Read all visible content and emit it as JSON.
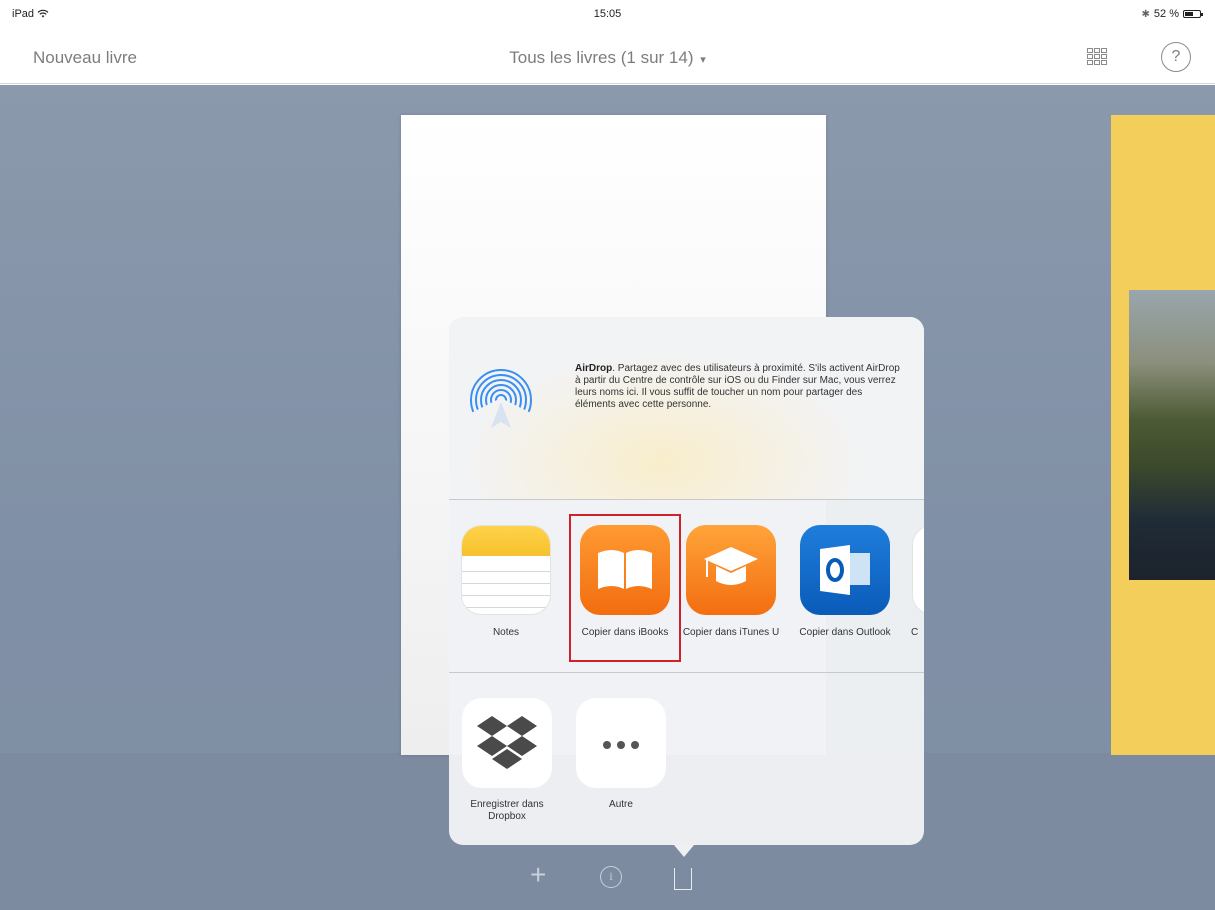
{
  "status_bar": {
    "device": "iPad",
    "time": "15:05",
    "battery": "52 %"
  },
  "nav": {
    "left_button": "Nouveau livre",
    "title": "Tous les livres (1 sur 14)",
    "title_caret": "▾",
    "help": "?"
  },
  "share_sheet": {
    "airdrop": {
      "title": "AirDrop",
      "description": ". Partagez avec des utilisateurs à proximité. S'ils activent AirDrop à partir du Centre de contrôle sur iOS ou du Finder sur Mac, vous verrez leurs noms ici. Il vous suffit de toucher un nom pour partager des éléments avec cette personne."
    },
    "apps": [
      {
        "label": "Notes",
        "icon": "notes-icon"
      },
      {
        "label": "Copier dans iBooks",
        "icon": "ibooks-icon"
      },
      {
        "label": "Copier dans iTunes U",
        "icon": "itunes-u-icon"
      },
      {
        "label": "Copier dans Outlook",
        "icon": "outlook-icon"
      },
      {
        "label": "C",
        "icon": "partial-app-icon"
      }
    ],
    "actions": [
      {
        "label": "Enregistrer dans Dropbox",
        "icon": "dropbox-icon"
      },
      {
        "label": "Autre",
        "icon": "more-icon"
      }
    ]
  },
  "toolbar": {
    "info_glyph": "i"
  },
  "colors": {
    "accent_highlight": "#d0202a",
    "background": "#8191a8",
    "book_yellow": "#f4ce5a"
  }
}
